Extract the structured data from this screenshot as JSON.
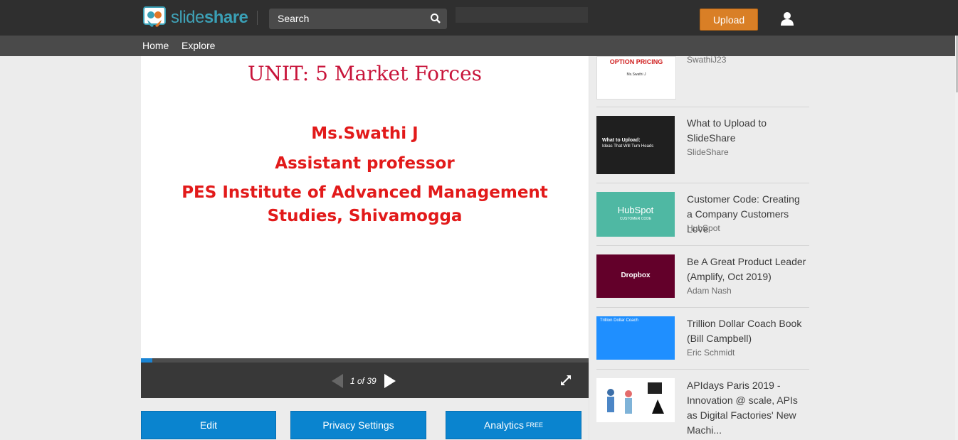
{
  "header": {
    "logo_text_a": "slide",
    "logo_text_b": "share",
    "search_placeholder": "Search",
    "upload_label": "Upload",
    "colors": {
      "bar": "#2f2f2f",
      "upload": "#d97f26",
      "brand": "#3aa0b6"
    }
  },
  "nav": {
    "items": [
      {
        "label": "Home"
      },
      {
        "label": "Explore"
      }
    ]
  },
  "slide": {
    "title": "UNIT: 5 Market Forces",
    "lines": [
      "Ms.Swathi J",
      "Assistant professor",
      "PES Institute of Advanced Management",
      "Studies, Shivamogga"
    ]
  },
  "player": {
    "page_text": "1 of 39",
    "progress": 0.025
  },
  "actions": {
    "edit": "Edit",
    "privacy": "Privacy Settings",
    "analytics": "Analytics",
    "analytics_badge": "FREE"
  },
  "related": [
    {
      "title": "",
      "author": "SwathiJ23",
      "thumb_title": "OPTION PRICING",
      "thumb_sub": "Ms.Swathi J"
    },
    {
      "title": "What to Upload to SlideShare",
      "author": "SlideShare",
      "thumb_title": "What to Upload:",
      "thumb_sub": "Ideas That Will Turn Heads"
    },
    {
      "title": "Customer Code: Creating a Company Customers Love",
      "author": "HubSpot",
      "thumb_title": "HubSpot",
      "thumb_sub": "CUSTOMER CODE"
    },
    {
      "title": "Be A Great Product Leader (Amplify, Oct 2019)",
      "author": "Adam Nash",
      "thumb_title": "Dropbox",
      "thumb_sub": ""
    },
    {
      "title": "Trillion Dollar Coach Book (Bill Campbell)",
      "author": "Eric Schmidt",
      "thumb_title": "Trillion Dollar Coach",
      "thumb_sub": ""
    },
    {
      "title": "APIdays Paris 2019 - Innovation @ scale, APIs as Digital Factories' New Machi...",
      "author": "",
      "thumb_title": "",
      "thumb_sub": ""
    }
  ]
}
